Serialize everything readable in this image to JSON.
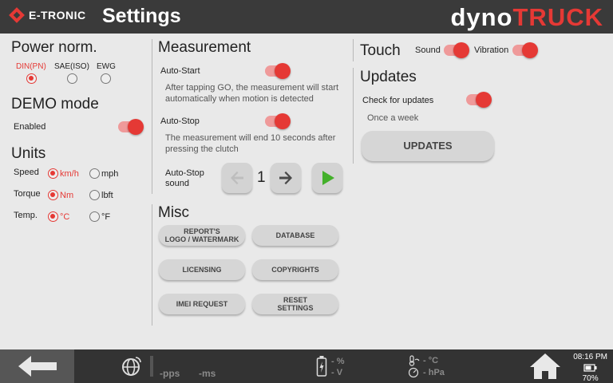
{
  "header": {
    "brand": "E-TRONIC",
    "title": "Settings",
    "logo_part1": "dyno",
    "logo_part2": "TRUCK"
  },
  "power_norm": {
    "title": "Power norm.",
    "options": [
      {
        "label": "DIN(PN)",
        "selected": true
      },
      {
        "label": "SAE(ISO)",
        "selected": false
      },
      {
        "label": "EWG",
        "selected": false
      }
    ]
  },
  "demo": {
    "title": "DEMO mode",
    "enabled_label": "Enabled",
    "enabled": true
  },
  "units": {
    "title": "Units",
    "speed_label": "Speed",
    "speed_options": [
      "km/h",
      "mph"
    ],
    "torque_label": "Torque",
    "torque_options": [
      "Nm",
      "lbft"
    ],
    "temp_label": "Temp.",
    "temp_options": [
      "°C",
      "°F"
    ]
  },
  "measurement": {
    "title": "Measurement",
    "auto_start_label": "Auto-Start",
    "auto_start_enabled": true,
    "auto_start_desc": "After tapping GO, the measurement will start automatically when motion is detected",
    "auto_stop_label": "Auto-Stop",
    "auto_stop_enabled": true,
    "auto_stop_desc": "The measurement will end 10 seconds after pressing the clutch",
    "auto_stop_sound_label": "Auto-Stop\nsound",
    "sound_value": "1"
  },
  "misc": {
    "title": "Misc",
    "buttons": {
      "report_logo": "REPORT'S\nLOGO / WATERMARK",
      "database": "DATABASE",
      "licensing": "LICENSING",
      "copyrights": "COPYRIGHTS",
      "imei_request": "IMEI REQUEST",
      "reset_settings": "RESET\nSETTINGS"
    }
  },
  "touch": {
    "title": "Touch",
    "sound_label": "Sound",
    "sound_enabled": true,
    "vibration_label": "Vibration",
    "vibration_enabled": true
  },
  "updates": {
    "title": "Updates",
    "check_label": "Check for updates",
    "check_enabled": true,
    "frequency": "Once a week",
    "button": "UPDATES"
  },
  "footer": {
    "pps": "-pps",
    "ms": "-ms",
    "battery_percent": "- %",
    "battery_volt": "- V",
    "temp": "- °C",
    "pressure": "- hPa",
    "time": "08:16 PM",
    "device_battery": "70%"
  },
  "colors": {
    "accent": "#e53935",
    "header_bg": "#3a3a3a",
    "footer_bg": "#333333",
    "background": "#e9e9e9",
    "play_green": "#43b02a"
  }
}
